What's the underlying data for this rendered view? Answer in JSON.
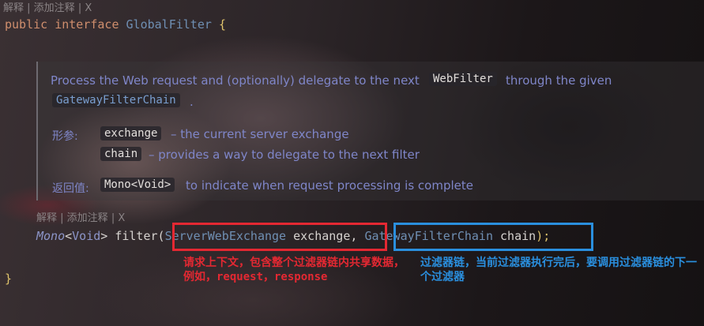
{
  "inlay_hint_top": {
    "explain": "解释",
    "sep": " | ",
    "add_comment": "添加注释",
    "sep2": " | ",
    "close": "X"
  },
  "inlay_hint_method": {
    "explain": "解释",
    "sep": " | ",
    "add_comment": "添加注释",
    "sep2": " | ",
    "close": "X"
  },
  "code": {
    "line1": {
      "kw1": "public",
      "kw2": "interface",
      "name": "GlobalFilter",
      "brace": "{"
    },
    "method": {
      "ret_type": "Mono",
      "generic_open": "<",
      "generic_arg": "Void",
      "generic_close": ">",
      "fn": "filter",
      "paren_open": "(",
      "param1_type": "ServerWebExchange",
      "param1_name": "exchange",
      "comma": ",",
      "param2_type": "GatewayFilterChain",
      "param2_name": "chain",
      "end": ");"
    },
    "close_brace": "}"
  },
  "doc": {
    "desc_part1": "Process the Web request and (optionally) delegate to the next",
    "desc_chip": "WebFilter",
    "desc_part2": "through the given",
    "desc_link": "GatewayFilterChain",
    "desc_end": ".",
    "params_label": "形参:",
    "param1_name": "exchange",
    "param1_desc": "– the current server exchange",
    "param2_name": "chain",
    "param2_desc": "– provides a way to delegate to the next filter",
    "return_label": "返回值:",
    "return_type": "Mono<Void>",
    "return_desc": "to indicate when request processing is complete"
  },
  "annotations": {
    "red_note": "请求上下文，包含整个过滤器链内共享数据，例如，request，response",
    "blue_note": "过滤器链，当前过滤器执行完后，要调用过滤器链的下一个过滤器",
    "red_color": "#e42832",
    "blue_color": "#2a8fde"
  }
}
